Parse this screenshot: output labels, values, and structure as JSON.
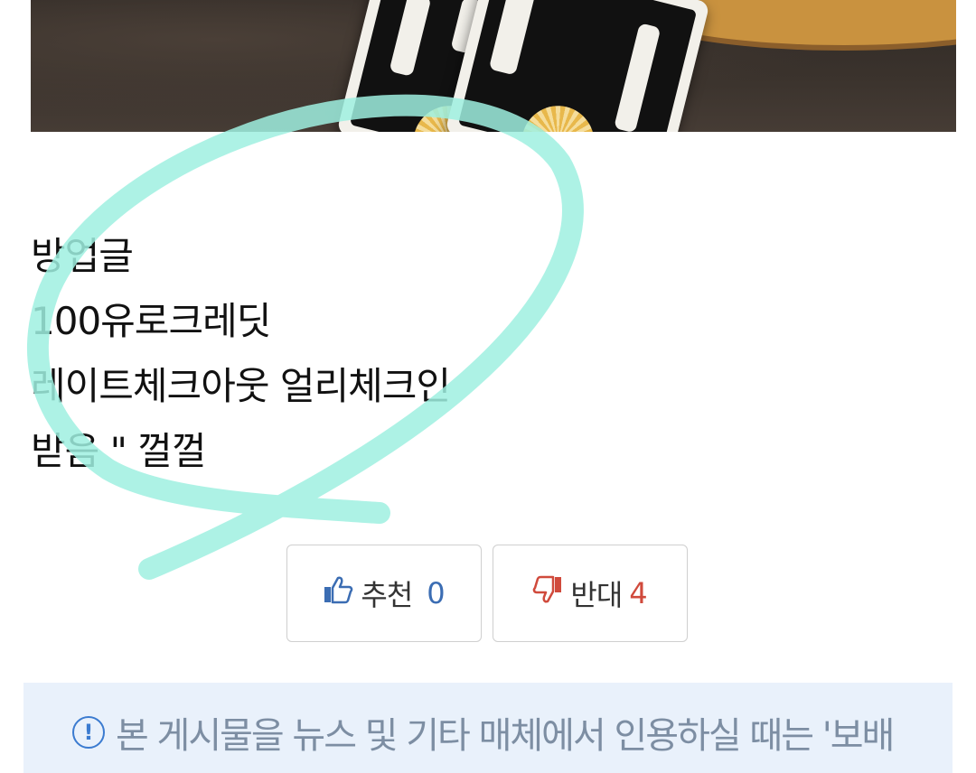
{
  "post": {
    "lines": [
      "방업글",
      "100유로크레딧",
      "레이트체크아웃 얼리체크인",
      "받음 \" 껄껄"
    ]
  },
  "votes": {
    "upvote_label": "추천",
    "upvote_count": "0",
    "downvote_label": "반대",
    "downvote_count": "4"
  },
  "notice": {
    "icon_text": "!",
    "text": "본 게시물을 뉴스 및 기타 매체에서 인용하실 때는 '보배"
  },
  "icons": {
    "thumbs_up": "thumbs-up-icon",
    "thumbs_down": "thumbs-down-icon",
    "info": "info-icon"
  },
  "colors": {
    "accent_blue": "#3b6db3",
    "downvote_red": "#d04a3c",
    "highlight_mint": "#9ff0e0",
    "notice_bg": "#e9f1fb"
  }
}
